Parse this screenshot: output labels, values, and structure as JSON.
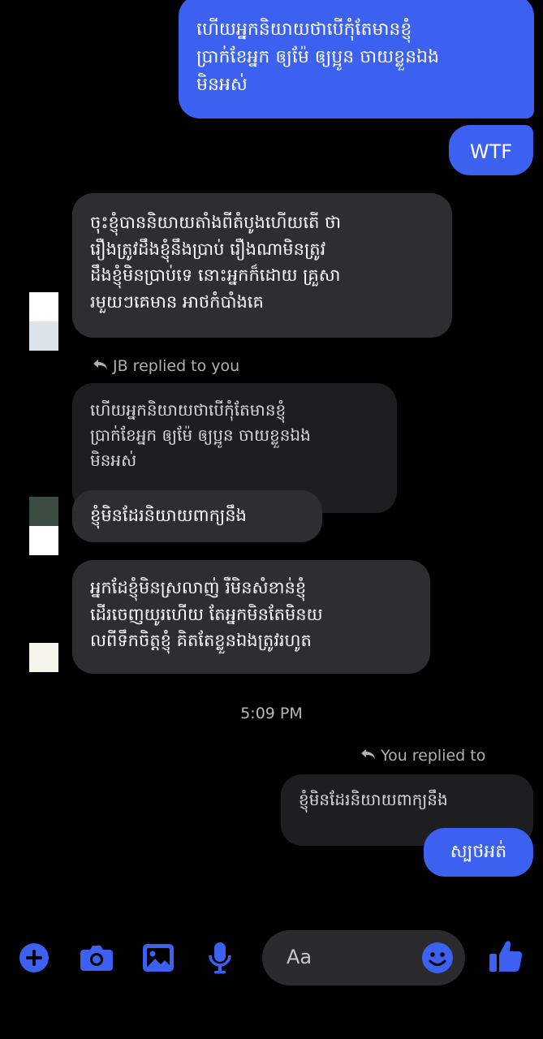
{
  "colors": {
    "accent": "#3c61f0",
    "background": "#000000",
    "received_bubble": "#2e2e31",
    "quoted_bubble": "#1e1e20"
  },
  "messages": {
    "m1_sent": "ហើយអ្នកនិយាយថាបើកុំតែមានខ្ញុំ\nប្រាក់ខែអ្នក ឲ្យម៉ែ ឲ្យប្អូន ចាយខ្លួនឯង\nមិនអស់",
    "m2_sent": "WTF",
    "m3_received": "ចុះខ្ញុំបាននិយាយតាំងពីតំបូងហើយតើ ថា\nរឿងត្រូវដឹងខ្ញុំនឹងប្រាប់ រឿងណាមិនត្រូវ\nដឹងខ្ញុំមិនប្រាប់ទេ នោះអ្នកក៏ដោយ គ្រួសា\nរមួយៗគេមាន អាថកំបាំងគេ",
    "reply1_label": "JB replied to you",
    "quoted1": "ហើយអ្នកនិយាយថាបើកុំតែមានខ្ញុំ\nប្រាក់ខែអ្នក ឲ្យម៉ែ ឲ្យប្អូន ចាយខ្លួនឯង\nមិនអស់",
    "m4_received": "ខ្ញុំមិនដែរនិយាយពាក្យនឹង",
    "m5_received": "អ្នកដែខ្ញុំមិនស្រលាញ់ រឺមិនសំខាន់ខ្ញុំ\nដើរចេញយូរហើយ តែអ្នកមិនតែមិនយ\nលពីទឹកចិត្តខ្ញុំ គិតតែខ្លួនឯងត្រូវរហូត",
    "timestamp": "5:09 PM",
    "reply2_label": "You replied to",
    "quoted2": "ខ្ញុំមិនដែរនិយាយពាក្យនឹង",
    "m6_sent": "ស្បថអត់"
  },
  "composer": {
    "placeholder": "Aa",
    "icons": [
      "plus-icon",
      "camera-icon",
      "image-icon",
      "microphone-icon",
      "emoji-icon",
      "thumbs-up-icon"
    ]
  }
}
